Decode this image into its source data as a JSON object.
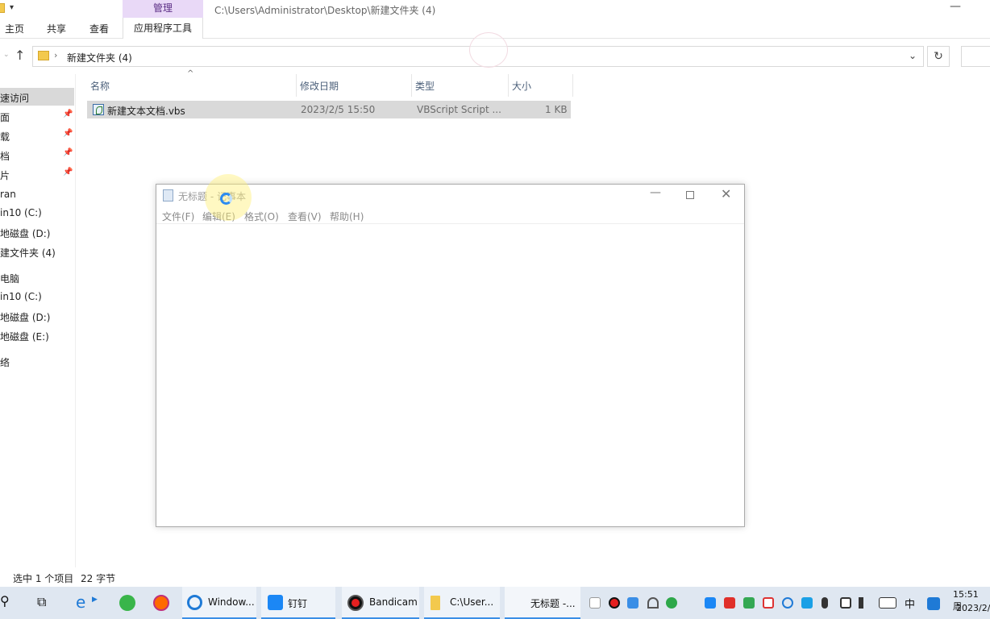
{
  "explorer": {
    "title_path": "C:\\Users\\Administrator\\Desktop\\新建文件夹 (4)",
    "manage_tab": "管理",
    "app_tools_tab": "应用程序工具",
    "ribbon_tabs": [
      "主页",
      "共享",
      "查看"
    ],
    "minimize_glyph": "—",
    "address": {
      "separator": "›",
      "folder": "新建文件夹 (4)",
      "dropdown_glyph": "⌄",
      "refresh_glyph": "↻",
      "up_glyph": "↑"
    },
    "nav_items": [
      {
        "label": "速访问",
        "selected": true,
        "pinned": false
      },
      {
        "label": "面",
        "selected": false,
        "pinned": true
      },
      {
        "label": "载",
        "selected": false,
        "pinned": true
      },
      {
        "label": "档",
        "selected": false,
        "pinned": true
      },
      {
        "label": "片",
        "selected": false,
        "pinned": true
      },
      {
        "label": "ran",
        "selected": false,
        "pinned": false
      },
      {
        "label": "in10 (C:)",
        "selected": false,
        "pinned": false
      },
      {
        "label": "地磁盘 (D:)",
        "selected": false,
        "pinned": false
      },
      {
        "label": "建文件夹 (4)",
        "selected": false,
        "pinned": false
      },
      {
        "label": "电脑",
        "selected": false,
        "pinned": false
      },
      {
        "label": "in10 (C:)",
        "selected": false,
        "pinned": false
      },
      {
        "label": "地磁盘 (D:)",
        "selected": false,
        "pinned": false
      },
      {
        "label": "地磁盘 (E:)",
        "selected": false,
        "pinned": false
      },
      {
        "label": "络",
        "selected": false,
        "pinned": false
      }
    ],
    "pin_glyph": "📌",
    "columns": {
      "name": "名称",
      "modified": "修改日期",
      "type": "类型",
      "size": "大小"
    },
    "files": [
      {
        "name": "新建文本文档.vbs",
        "modified": "2023/2/5 15:50",
        "type": "VBScript Script ...",
        "size": "1 KB"
      }
    ],
    "status_selected": "选中 1 个项目",
    "status_size": "22 字节"
  },
  "notepad": {
    "title": "无标题 - 记事本",
    "menus": [
      "文件(F)",
      "编辑(E)",
      "格式(O)",
      "查看(V)",
      "帮助(H)"
    ],
    "min_glyph": "—",
    "close_glyph": "✕",
    "content": ""
  },
  "taskbar": {
    "search_glyph": "⚲",
    "taskview_glyph": "⧉",
    "apps": [
      {
        "label": "Window...",
        "icon": "ie-icon"
      },
      {
        "label": "钉钉",
        "icon": "dingtalk-icon"
      },
      {
        "label": "Bandicam",
        "icon": "bandicam-icon"
      },
      {
        "label": "C:\\User...",
        "icon": "folder-icon"
      },
      {
        "label": "无标题 -...",
        "icon": "notepad-icon"
      }
    ],
    "ime": "中",
    "clock_time": "15:51 周",
    "clock_date": "2023/2/"
  },
  "colors": {
    "manage_tab_bg": "#e9d9f7",
    "selection_bg": "#d9d9d9",
    "taskbar_bg": "#dfe7f1"
  }
}
